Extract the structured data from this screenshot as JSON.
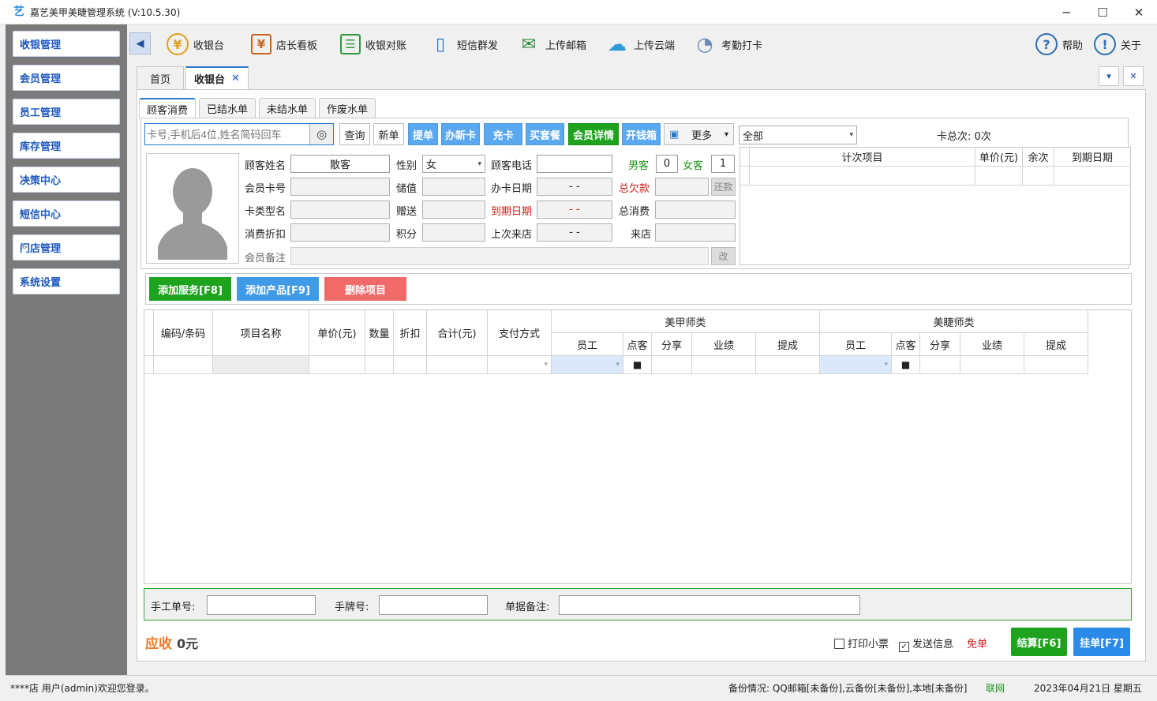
{
  "window": {
    "app_icon": "艺",
    "title": "嘉艺美甲美睫管理系统 (V:10.5.30)",
    "minimize": "─",
    "maximize": "☐",
    "close": "✕"
  },
  "sidebar": {
    "items": [
      {
        "label": "收银管理"
      },
      {
        "label": "会员管理"
      },
      {
        "label": "员工管理"
      },
      {
        "label": "库存管理"
      },
      {
        "label": "决策中心"
      },
      {
        "label": "短信中心"
      },
      {
        "label": "门店管理"
      },
      {
        "label": "系统设置"
      }
    ],
    "chevron": "≫"
  },
  "toolbar": {
    "collapse_glyph": "◀",
    "items": [
      {
        "label": "收银台",
        "icon": "cashier-icon",
        "glyph": "¥"
      },
      {
        "label": "店长看板",
        "icon": "dashboard-icon",
        "glyph": "¥"
      },
      {
        "label": "收银对账",
        "icon": "reconcile-icon",
        "glyph": "☰"
      },
      {
        "label": "短信群发",
        "icon": "sms-icon",
        "glyph": "▯"
      },
      {
        "label": "上传邮箱",
        "icon": "mail-upload-icon",
        "glyph": "✉"
      },
      {
        "label": "上传云端",
        "icon": "cloud-upload-icon",
        "glyph": "☁"
      },
      {
        "label": "考勤打卡",
        "icon": "attendance-icon",
        "glyph": "◔"
      }
    ],
    "help_label": "帮助",
    "help_glyph": "?",
    "about_label": "关于",
    "about_glyph": "!"
  },
  "doc_tabs": {
    "home": "首页",
    "cashier": "收银台",
    "close_glyph": "✕",
    "menu_glyph": "▾",
    "close_all_glyph": "✕"
  },
  "sub_tabs": [
    "顾客消费",
    "已结水单",
    "未结水单",
    "作废水单"
  ],
  "search": {
    "placeholder": "卡号,手机后4位,姓名简码回车",
    "fingerprint_glyph": "◎"
  },
  "buttons": {
    "query": "查询",
    "new_order": "新单",
    "take_order": "提单",
    "new_card": "办新卡",
    "recharge": "充卡",
    "buy_package": "买套餐",
    "member_detail": "会员详情",
    "open_drawer": "开钱箱",
    "more": "更多",
    "more_arrow": "▾",
    "more_icon": "▣",
    "repay": "还款",
    "edit_remark": "改"
  },
  "filter": {
    "value": "全部",
    "arrow": "▾"
  },
  "card_total": "卡总次: 0次",
  "customer": {
    "name_label": "顾客姓名",
    "name_value": "散客",
    "gender_label": "性别",
    "gender_value": "女",
    "phone_label": "顾客电话",
    "male_label": "男客",
    "male_count": "0",
    "female_label": "女客",
    "female_count": "1",
    "card_no_label": "会员卡号",
    "balance_label": "储值",
    "open_date_label": "办卡日期",
    "open_date_value": "- -",
    "debt_label": "总欠款",
    "card_type_label": "卡类型名",
    "gift_label": "赠送",
    "expire_label": "到期日期",
    "expire_value": "- -",
    "total_spend_label": "总消费",
    "discount_label": "消费折扣",
    "points_label": "积分",
    "last_visit_label": "上次来店",
    "last_visit_value": "- -",
    "visits_label": "来店",
    "remark_label": "会员备注"
  },
  "count_table": {
    "headers": [
      "计次项目",
      "单价(元)",
      "余次",
      "到期日期"
    ]
  },
  "actions": {
    "add_service": "添加服务[F8]",
    "add_product": "添加产品[F9]",
    "delete_item": "删除项目"
  },
  "items_table": {
    "headers": [
      "编码/条码",
      "项目名称",
      "单价(元)",
      "数量",
      "折扣",
      "合计(元)",
      "支付方式"
    ],
    "nail_group": "美甲师类",
    "lash_group": "美睫师类",
    "sub_headers": [
      "员工",
      "点客",
      "分享",
      "业绩",
      "提成"
    ],
    "checkbox_glyph": "■"
  },
  "bottom": {
    "manual_no": "手工单号:",
    "tag_no": "手牌号:",
    "remark": "单据备注:"
  },
  "footer": {
    "receivable_label": "应收",
    "receivable_value": "0元",
    "print_receipt": "打印小票",
    "send_message": "发送信息",
    "free_order": "免单",
    "checkout": "结算[F6]",
    "hold": "挂单[F7]",
    "check_glyph": "✓"
  },
  "status": {
    "welcome": "****店 用户(admin)欢迎您登录。",
    "backup": "备份情况: QQ邮箱[未备份],云备份[未备份],本地[未备份]",
    "network": "联网",
    "date": "2023年04月21日 星期五"
  },
  "colors": {
    "accent_blue": "#2a78c9",
    "green": "#1ea31e",
    "light_blue": "#5aa9f0",
    "red_button": "#f06a6a",
    "receivable": "#e87a2b"
  }
}
